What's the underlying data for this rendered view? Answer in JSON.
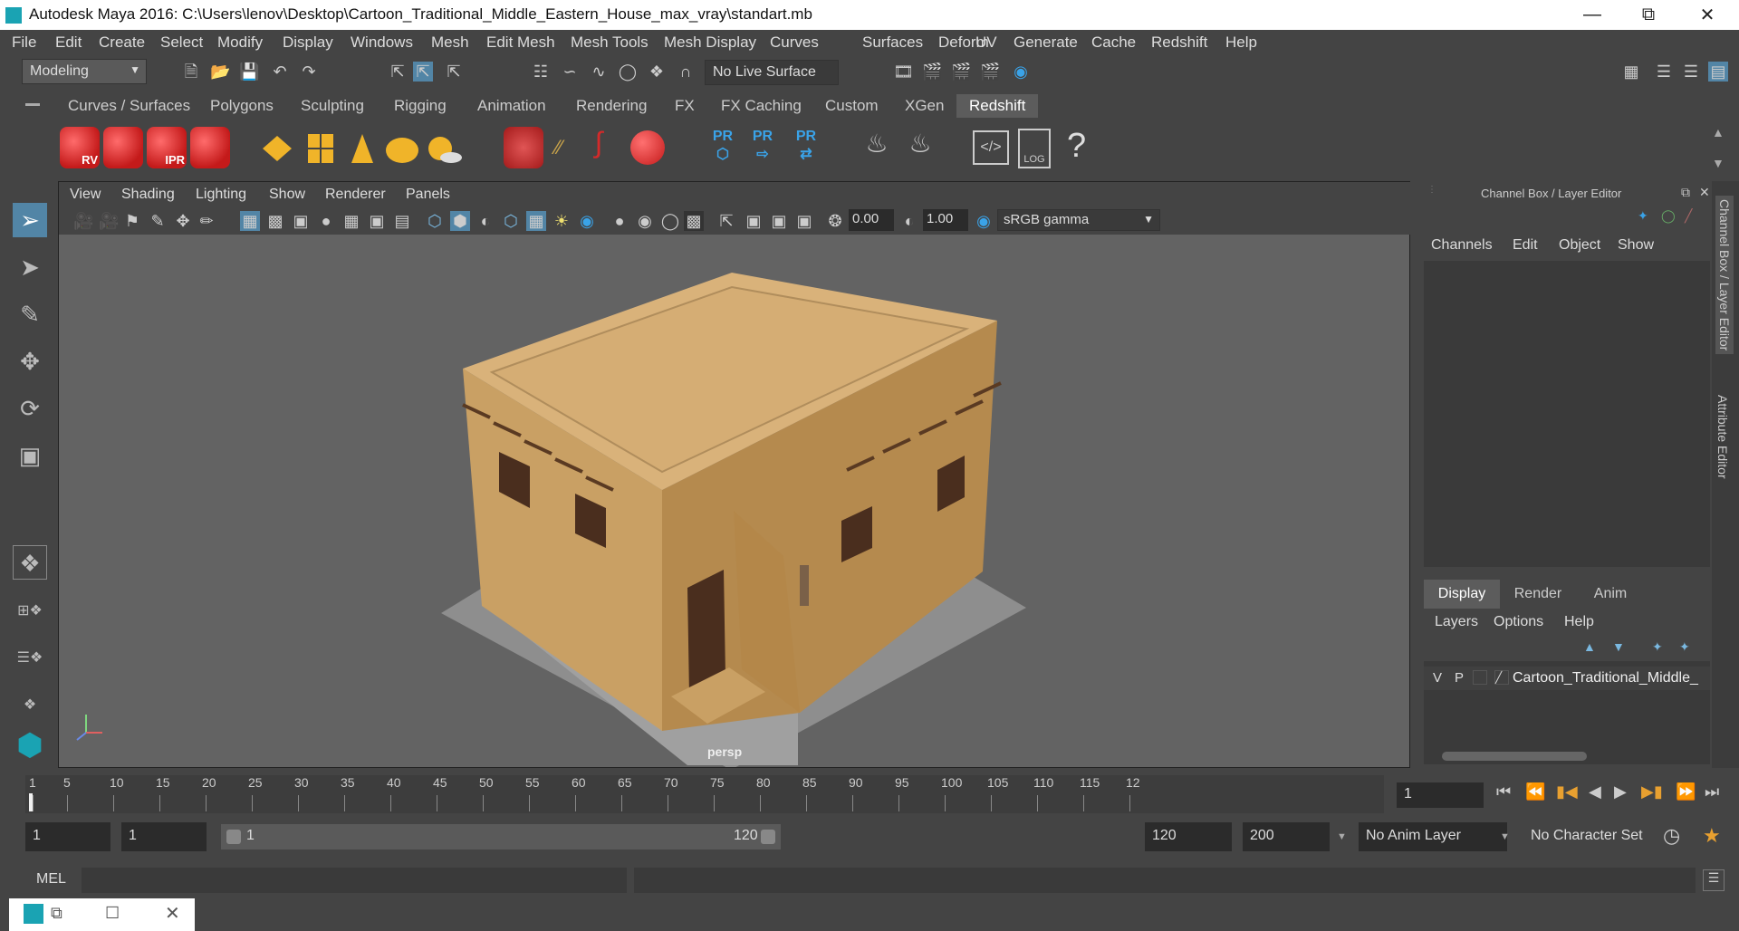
{
  "titlebar": {
    "title": "Autodesk Maya 2016: C:\\Users\\lenov\\Desktop\\Cartoon_Traditional_Middle_Eastern_House_max_vray\\standart.mb"
  },
  "menubar": [
    "File",
    "Edit",
    "Create",
    "Select",
    "Modify",
    "Display",
    "Windows",
    "Mesh",
    "Edit Mesh",
    "Mesh Tools",
    "Mesh Display",
    "Curves",
    "Surfaces",
    "Deform",
    "UV",
    "Generate",
    "Cache",
    "Redshift",
    "Help"
  ],
  "statusline": {
    "mode": "Modeling",
    "live_surface": "No Live Surface"
  },
  "shelf_tabs": [
    "Curves / Surfaces",
    "Polygons",
    "Sculpting",
    "Rigging",
    "Animation",
    "Rendering",
    "FX",
    "FX Caching",
    "Custom",
    "XGen",
    "Redshift"
  ],
  "shelf_active": "Redshift",
  "shelf_labels": {
    "rv": "RV",
    "ipr": "IPR",
    "pr1": "PR",
    "pr2": "PR",
    "pr3": "PR",
    "log": "LOG",
    "help": "?"
  },
  "viewport": {
    "menu": [
      "View",
      "Shading",
      "Lighting",
      "Show",
      "Renderer",
      "Panels"
    ],
    "exposure": "0.00",
    "gamma": "1.00",
    "color_space": "sRGB gamma",
    "camera": "persp"
  },
  "channelbox": {
    "title": "Channel Box / Layer Editor",
    "menu": [
      "Channels",
      "Edit",
      "Object",
      "Show"
    ],
    "layer_tabs": [
      "Display",
      "Render",
      "Anim"
    ],
    "layer_menu": [
      "Layers",
      "Options",
      "Help"
    ],
    "layer": {
      "v": "V",
      "p": "P",
      "name": "Cartoon_Traditional_Middle_"
    }
  },
  "side_tabs": [
    "Channel Box / Layer Editor",
    "Attribute Editor"
  ],
  "timeline": {
    "ticks": [
      "1",
      "5",
      "10",
      "15",
      "20",
      "25",
      "30",
      "35",
      "40",
      "45",
      "50",
      "55",
      "60",
      "65",
      "70",
      "75",
      "80",
      "85",
      "90",
      "95",
      "100",
      "105",
      "110",
      "115",
      "12"
    ],
    "current_frame": "1"
  },
  "range": {
    "start": "1",
    "playback_start": "1",
    "slider_start": "1",
    "slider_end": "120",
    "playback_end": "120",
    "end": "200",
    "anim_layer": "No Anim Layer",
    "char_set": "No Character Set"
  },
  "cmd": {
    "lang": "MEL"
  },
  "colors": {
    "bg": "#444444",
    "scene": "#636363",
    "accent": "#5285a6",
    "shelf_red": "#d42a2a",
    "shelf_yellow": "#f0b429",
    "pr_blue": "#3aa3e8"
  }
}
